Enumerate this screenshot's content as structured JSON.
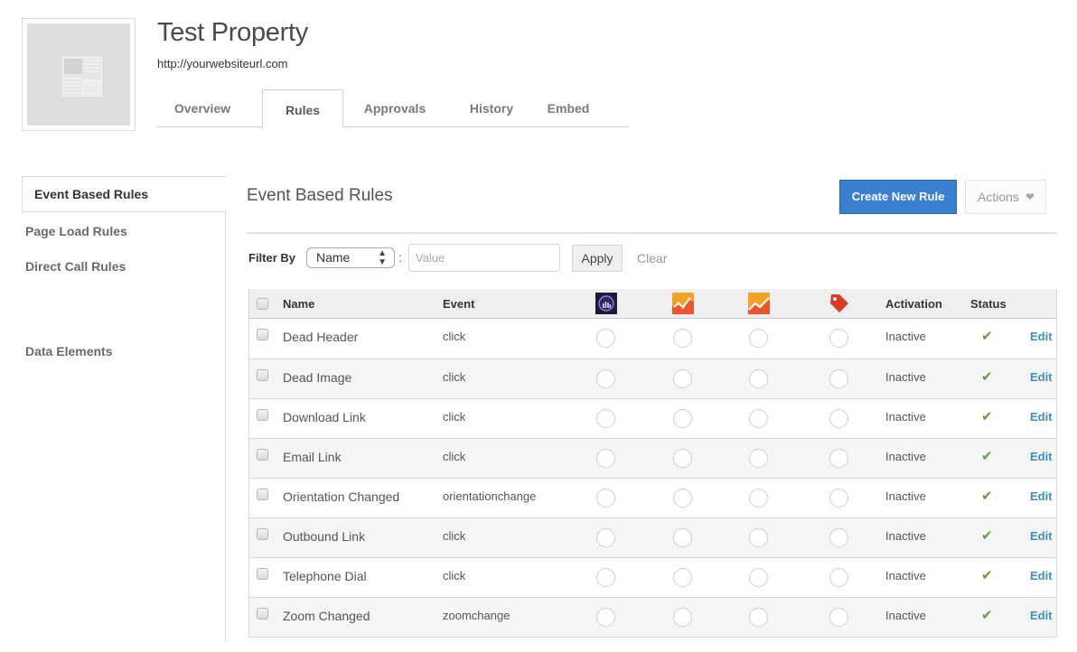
{
  "property": {
    "title": "Test Property",
    "url": "http://yourwebsiteurl.com"
  },
  "tabs": [
    {
      "label": "Overview",
      "active": false
    },
    {
      "label": "Rules",
      "active": true
    },
    {
      "label": "Approvals",
      "active": false
    },
    {
      "label": "History",
      "active": false
    },
    {
      "label": "Embed",
      "active": false
    }
  ],
  "sidebar": {
    "items": [
      {
        "label": "Event Based Rules",
        "active": true
      },
      {
        "label": "Page Load Rules",
        "active": false
      },
      {
        "label": "Direct Call Rules",
        "active": false
      },
      {
        "label": "Data Elements",
        "active": false
      }
    ]
  },
  "main": {
    "title": "Event Based Rules",
    "create_button": "Create New Rule",
    "actions_button": "Actions",
    "actions_icon": "chevron-down-icon",
    "filter": {
      "label": "Filter By",
      "select_value": "Name",
      "colon": ":",
      "input_value": "",
      "input_placeholder": "Value",
      "apply_label": "Apply",
      "clear_label": "Clear"
    }
  },
  "table": {
    "headers": {
      "name": "Name",
      "event": "Event",
      "tool_icons": [
        "adobe-analytics-icon",
        "google-analytics-icon",
        "google-universal-analytics-icon",
        "tag-icon"
      ],
      "activation": "Activation",
      "status": "Status"
    },
    "colors": {
      "analytics_bg": "#1e1b3a",
      "ga_orange": "#f4a024",
      "ga_red": "#e9562d",
      "tag_red": "#d93a26",
      "check_green": "#5a9e3c",
      "link_blue": "#3b8dc8"
    },
    "edit_label": "Edit",
    "status_icon": "checkmark-icon",
    "rows": [
      {
        "name": "Dead Header",
        "event": "click",
        "activation": "Inactive",
        "status": "active"
      },
      {
        "name": "Dead Image",
        "event": "click",
        "activation": "Inactive",
        "status": "active"
      },
      {
        "name": "Download Link",
        "event": "click",
        "activation": "Inactive",
        "status": "active"
      },
      {
        "name": "Email Link",
        "event": "click",
        "activation": "Inactive",
        "status": "active"
      },
      {
        "name": "Orientation Changed",
        "event": "orientationchange",
        "activation": "Inactive",
        "status": "active"
      },
      {
        "name": "Outbound Link",
        "event": "click",
        "activation": "Inactive",
        "status": "active"
      },
      {
        "name": "Telephone Dial",
        "event": "click",
        "activation": "Inactive",
        "status": "active"
      },
      {
        "name": "Zoom Changed",
        "event": "zoomchange",
        "activation": "Inactive",
        "status": "active"
      }
    ]
  }
}
